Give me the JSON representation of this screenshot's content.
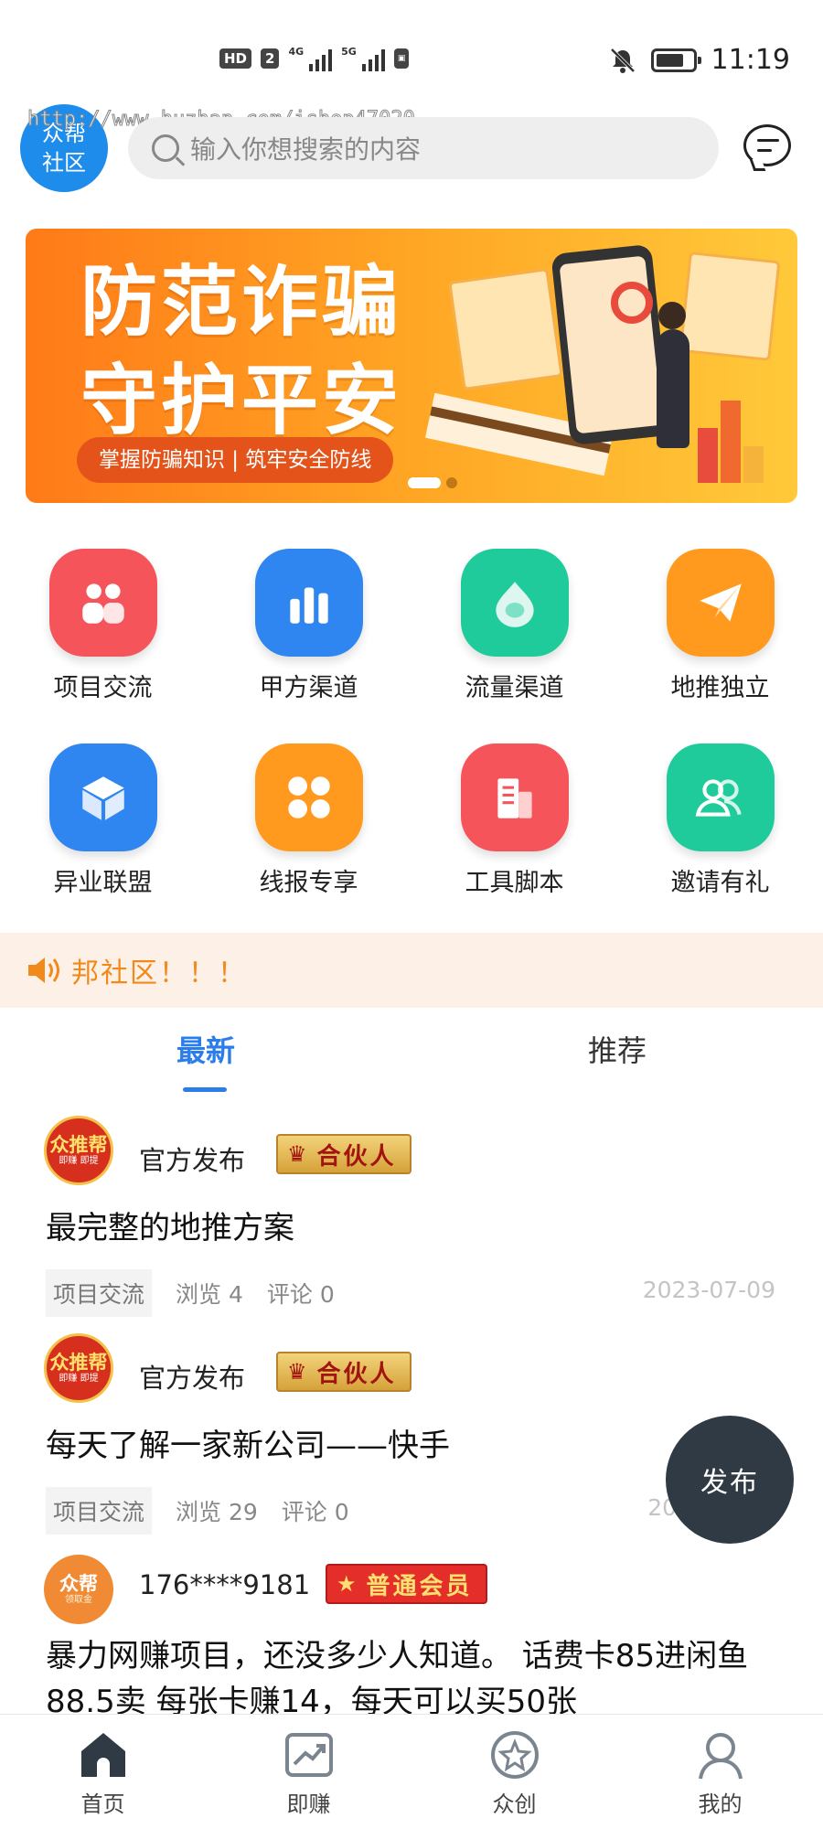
{
  "status_bar": {
    "hd": "HD",
    "sim": "2",
    "net1": "4G",
    "net2": "5G",
    "time": "11:19",
    "battery_level": 0.75
  },
  "header": {
    "logo_text_line1": "众帮",
    "logo_text_line2": "社区",
    "watermark": "http://www.huzhan.com/ishop47020",
    "search_placeholder": "输入你想搜索的内容"
  },
  "banner": {
    "title_line1": "防范诈骗",
    "title_line2": "守护平安",
    "subtitle": "掌握防骗知识 | 筑牢安全防线",
    "slide_count": 2,
    "active_slide": 1
  },
  "grid": [
    {
      "label": "项目交流",
      "icon": "people-icon",
      "color": "#f5555a"
    },
    {
      "label": "甲方渠道",
      "icon": "bar-chart-icon",
      "color": "#2f86f0"
    },
    {
      "label": "流量渠道",
      "icon": "drop-icon",
      "color": "#1fcb9a"
    },
    {
      "label": "地推独立",
      "icon": "paper-plane-icon",
      "color": "#ff9a1f"
    },
    {
      "label": "异业联盟",
      "icon": "cube-icon",
      "color": "#2f86f0"
    },
    {
      "label": "线报专享",
      "icon": "clover-icon",
      "color": "#ff9a1f"
    },
    {
      "label": "工具脚本",
      "icon": "building-icon",
      "color": "#f5555a"
    },
    {
      "label": "邀请有礼",
      "icon": "group-icon",
      "color": "#1fcb9a"
    }
  ],
  "notice": {
    "text": "邦社区！！！"
  },
  "tabs": [
    {
      "label": "最新",
      "active": true
    },
    {
      "label": "推荐",
      "active": false
    }
  ],
  "posts": [
    {
      "avatar_text": "众推帮",
      "avatar_sub": "即赚 即提",
      "author": "官方发布",
      "badge": "合伙人",
      "title": "最完整的地推方案",
      "category": "项目交流",
      "views": "浏览 4",
      "comments": "评论 0",
      "date": "2023-07-09"
    },
    {
      "avatar_text": "众推帮",
      "avatar_sub": "即赚 即提",
      "author": "官方发布",
      "badge": "合伙人",
      "title": "每天了解一家新公司——快手",
      "category": "项目交流",
      "views": "浏览 29",
      "comments": "评论 0",
      "date": "20"
    },
    {
      "avatar_text": "众帮",
      "avatar_sub": "领取金",
      "author": "176****9181",
      "badge": "普通会员",
      "title": "暴力网赚项目，还没多少人知道。 话费卡85进闲鱼88.5卖 每张卡赚14，每天可以买50张"
    }
  ],
  "fab": {
    "label": "发布"
  },
  "bottom_nav": [
    {
      "label": "首页",
      "icon": "home-icon",
      "active": true
    },
    {
      "label": "即赚",
      "icon": "trend-icon",
      "active": false
    },
    {
      "label": "众创",
      "icon": "star-icon",
      "active": false
    },
    {
      "label": "我的",
      "icon": "user-icon",
      "active": false
    }
  ]
}
